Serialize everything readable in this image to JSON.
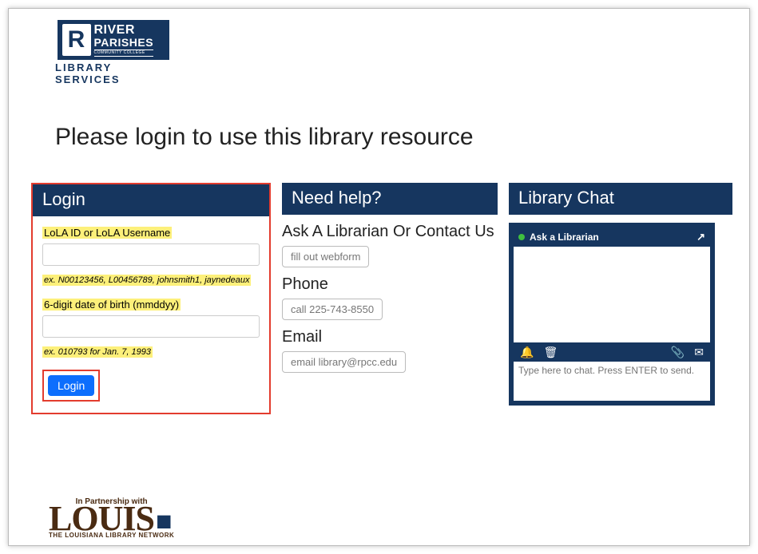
{
  "brand": {
    "line1": "RIVER",
    "line2": "PARISHES",
    "line3": "COMMUNITY COLLEGE",
    "subtitle": "LIBRARY SERVICES"
  },
  "pageTitle": "Please login to use this library resource",
  "login": {
    "heading": "Login",
    "userLabel": "LoLA ID or LoLA Username",
    "userHint": "ex. N00123456, L00456789, johnsmith1, jaynedeaux",
    "passLabel": "6-digit date of birth (mmddyy)",
    "passHint": "ex. 010793 for Jan. 7, 1993",
    "button": "Login"
  },
  "help": {
    "heading": "Need help?",
    "ask": {
      "title": "Ask A Librarian Or Contact Us",
      "button": "fill out webform"
    },
    "phone": {
      "title": "Phone",
      "button": "call 225-743-8550"
    },
    "email": {
      "title": "Email",
      "button": "email library@rpcc.edu"
    }
  },
  "chat": {
    "heading": "Library Chat",
    "widgetTitle": "Ask a Librarian",
    "placeholder": "Type here to chat. Press ENTER to send."
  },
  "footer": {
    "top": "In Partnership with",
    "big": "LOUIS",
    "bottom": "THE LOUISIANA LIBRARY NETWORK"
  }
}
